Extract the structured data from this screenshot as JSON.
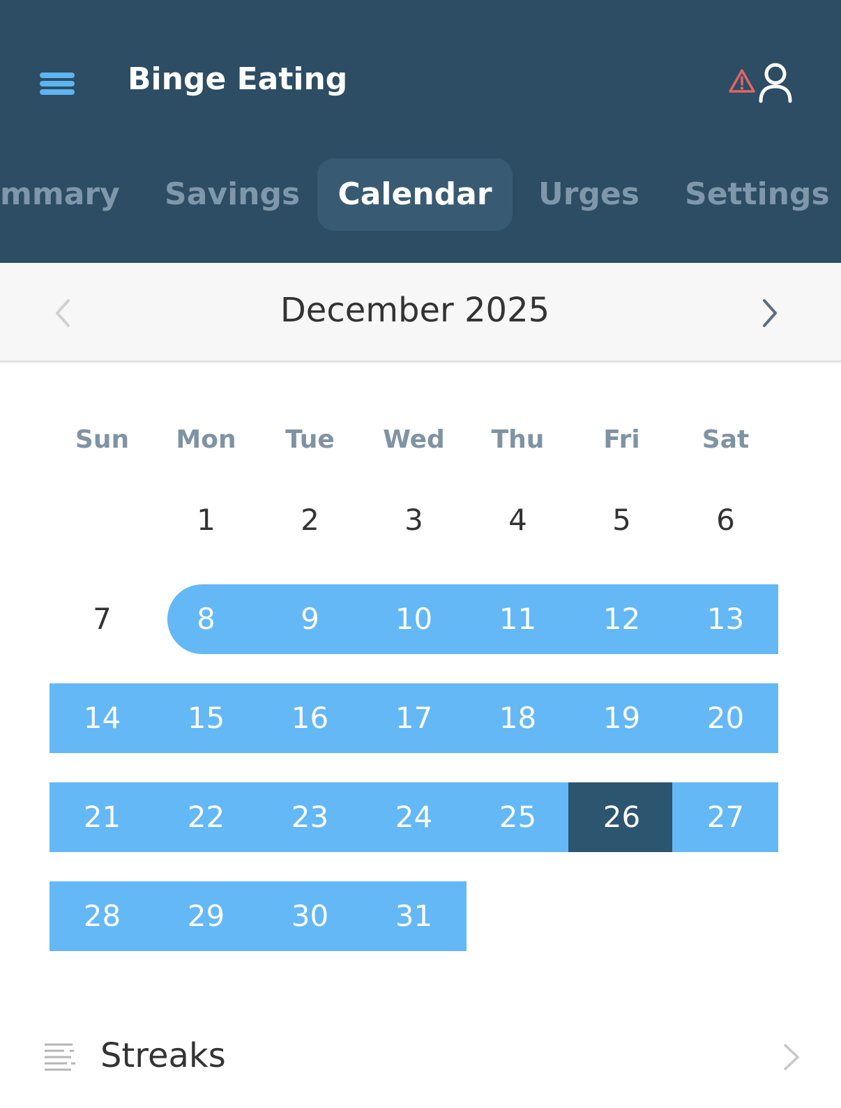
{
  "header": {
    "title": "Binge Eating"
  },
  "tabs": [
    {
      "label": "mmary"
    },
    {
      "label": "Savings"
    },
    {
      "label": "Calendar"
    },
    {
      "label": "Urges"
    },
    {
      "label": "Settings"
    }
  ],
  "active_tab": "Calendar",
  "calendar": {
    "month_title": "December 2025",
    "weekdays": [
      "Sun",
      "Mon",
      "Tue",
      "Wed",
      "Thu",
      "Fri",
      "Sat"
    ],
    "first_weekday_index": 1,
    "days": [
      "1",
      "2",
      "3",
      "4",
      "5",
      "6",
      "7",
      "8",
      "9",
      "10",
      "11",
      "12",
      "13",
      "14",
      "15",
      "16",
      "17",
      "18",
      "19",
      "20",
      "21",
      "22",
      "23",
      "24",
      "25",
      "26",
      "27",
      "28",
      "29",
      "30",
      "31"
    ],
    "highlighted_range": {
      "start": 8,
      "end": 31
    },
    "today": 26
  },
  "streaks": {
    "label": "Streaks"
  },
  "colors": {
    "header_bg": "#2c4d63",
    "active_tab_bg": "#385a72",
    "range_fill": "#63b8f5",
    "today_fill": "#2c5570",
    "menu_icon": "#5db4f2",
    "warning": "#e06666"
  },
  "icons": {
    "menu": "hamburger-icon",
    "warning": "warning-triangle-icon",
    "profile": "user-profile-icon",
    "prev": "chevron-left-icon",
    "next": "chevron-right-icon",
    "streaks": "list-lines-icon",
    "streaks_open": "chevron-right-icon"
  }
}
